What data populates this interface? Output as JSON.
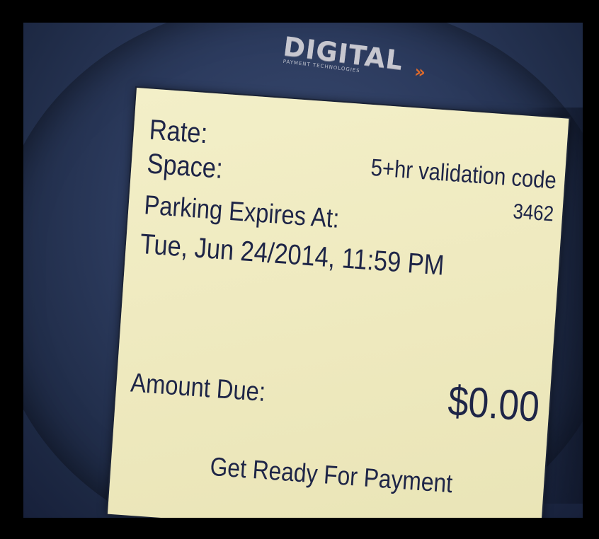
{
  "brand": {
    "name": "DIGITAL",
    "tagline": "PAYMENT TECHNOLOGIES",
    "accent": "»"
  },
  "screen": {
    "rate_label": "Rate:",
    "space_label": "Space:",
    "rate_value": "5+hr validation code",
    "space_value": "3462",
    "expires_label": "Parking Expires At:",
    "expires_value": "Tue, Jun 24/2014, 11:59 PM",
    "amount_label": "Amount Due:",
    "amount_value": "$0.00",
    "prompt": "Get Ready For Payment"
  },
  "colors": {
    "lcd_background": "#f0ecc2",
    "lcd_text": "#1e2547",
    "housing": "#2c3b5e",
    "logo_accent": "#e06a2a"
  }
}
